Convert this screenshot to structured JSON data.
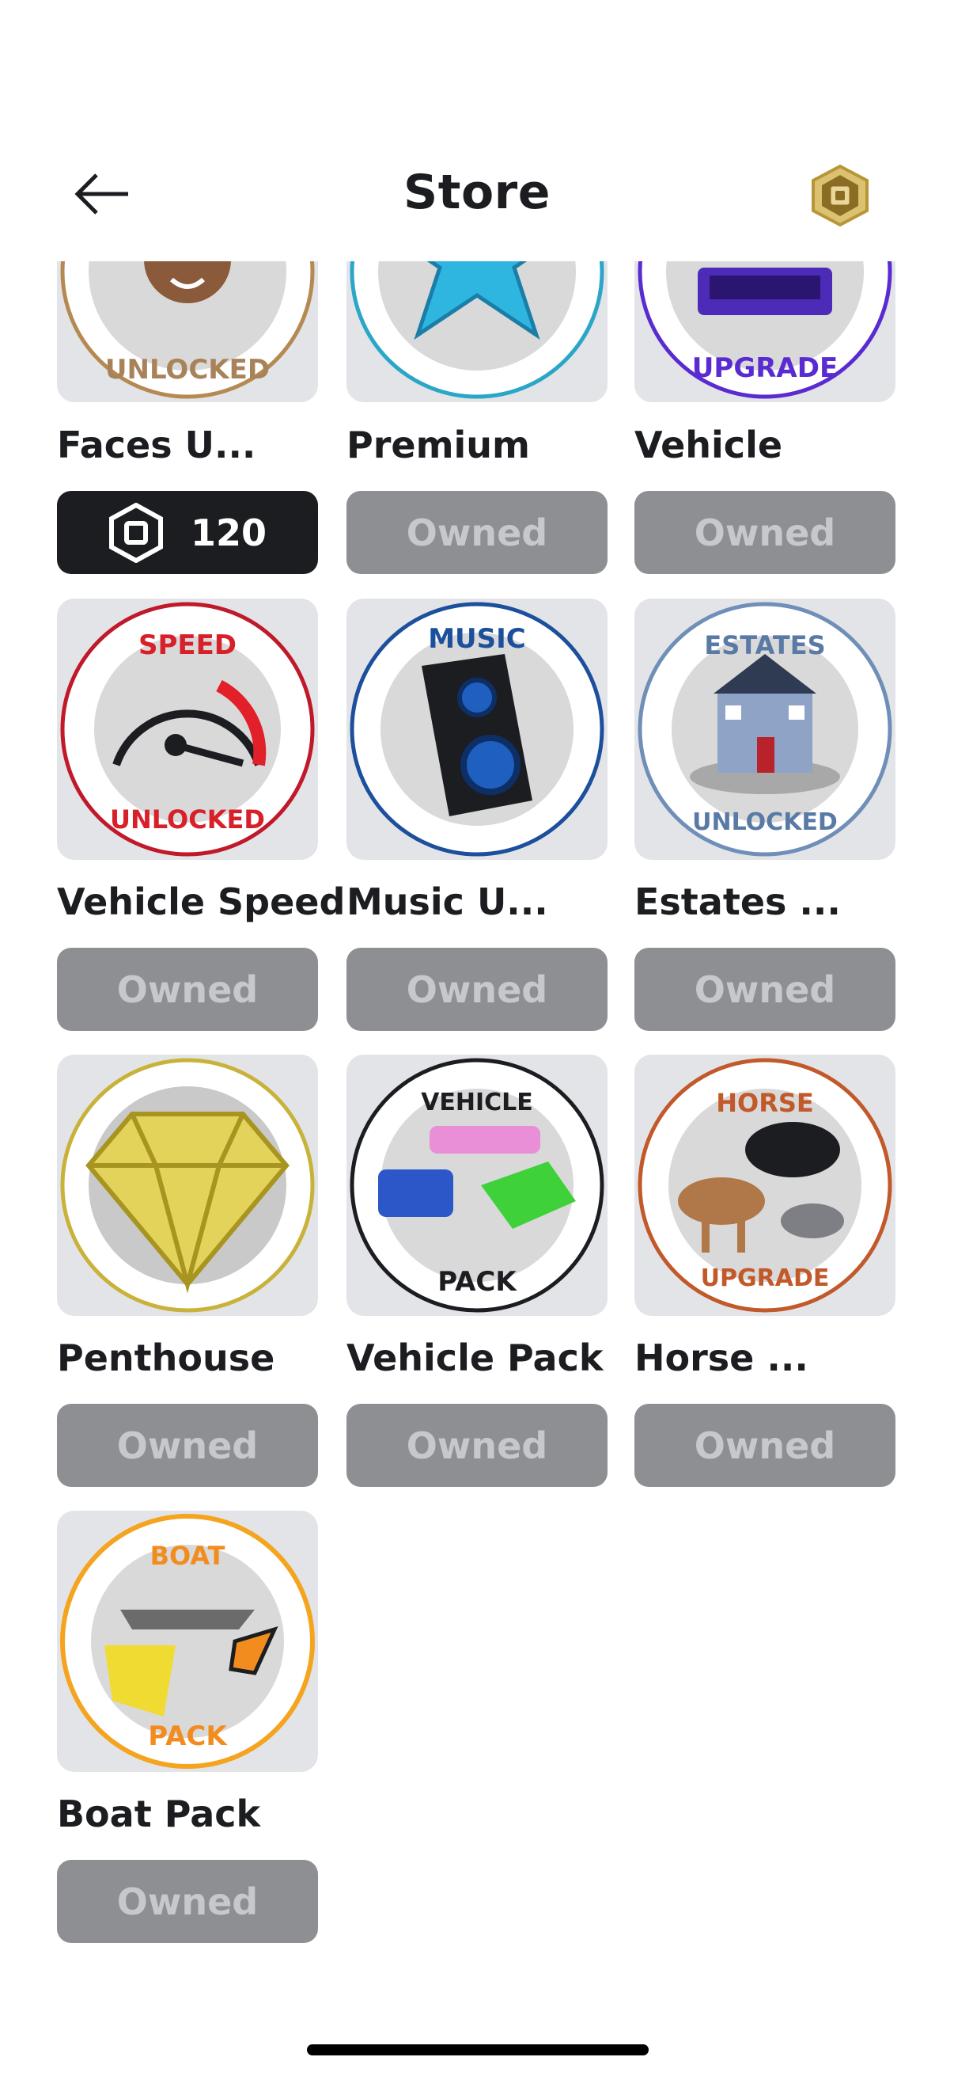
{
  "header": {
    "title": "Store",
    "back_icon": "arrow-left-icon",
    "currency_icon": "robux-icon"
  },
  "colors": {
    "card_bg": "#e3e4e8",
    "owned_btn": "#8e8f93",
    "buy_btn": "#1b1d21"
  },
  "items": [
    {
      "name": "Faces U...",
      "button": {
        "type": "price",
        "price": "120",
        "icon": "robux-icon"
      },
      "badge_text": "UNLOCKED"
    },
    {
      "name": "Premium",
      "button": {
        "type": "owned",
        "label": "Owned"
      }
    },
    {
      "name": "Vehicle",
      "button": {
        "type": "owned",
        "label": "Owned"
      },
      "badge_text": "UPGRADE"
    },
    {
      "name": "Vehicle Speed",
      "button": {
        "type": "owned",
        "label": "Owned"
      },
      "badge_top": "SPEED",
      "badge_bottom": "UNLOCKED"
    },
    {
      "name": "Music U...",
      "button": {
        "type": "owned",
        "label": "Owned"
      },
      "badge_top": "MUSIC"
    },
    {
      "name": "Estates ...",
      "button": {
        "type": "owned",
        "label": "Owned"
      },
      "badge_top": "ESTATES",
      "badge_bottom": "UNLOCKED"
    },
    {
      "name": "Penthouse",
      "button": {
        "type": "owned",
        "label": "Owned"
      }
    },
    {
      "name": "Vehicle Pack",
      "button": {
        "type": "owned",
        "label": "Owned"
      },
      "badge_top": "VEHICLE",
      "badge_bottom": "PACK"
    },
    {
      "name": "Horse ...",
      "button": {
        "type": "owned",
        "label": "Owned"
      },
      "badge_top": "HORSE",
      "badge_bottom": "UPGRADE"
    },
    {
      "name": "Boat Pack",
      "button": {
        "type": "owned",
        "label": "Owned"
      },
      "badge_top": "BOAT",
      "badge_bottom": "PACK"
    }
  ]
}
